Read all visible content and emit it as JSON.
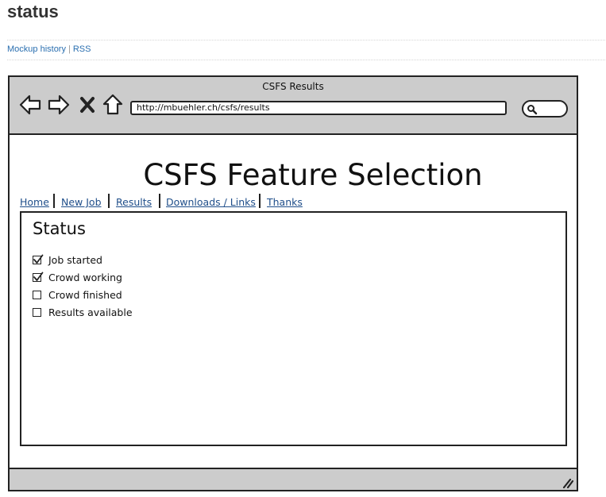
{
  "page": {
    "title": "status",
    "links": [
      {
        "label": "Mockup history"
      },
      {
        "label": "RSS"
      }
    ],
    "link_separator": "|"
  },
  "browser": {
    "window_title": "CSFS Results",
    "url": "http://mbuehler.ch/csfs/results",
    "icons": [
      "back-arrow-icon",
      "forward-arrow-icon",
      "close-x-icon",
      "home-icon",
      "search-icon",
      "resize-grip-icon"
    ]
  },
  "app": {
    "title": "CSFS Feature Selection",
    "tabs": [
      {
        "label": "Home"
      },
      {
        "label": "New Job"
      },
      {
        "label": "Results"
      },
      {
        "label": "Downloads / Links"
      },
      {
        "label": "Thanks"
      }
    ],
    "section_title": "Status",
    "status_items": [
      {
        "label": "Job started",
        "checked": true
      },
      {
        "label": "Crowd working",
        "checked": true
      },
      {
        "label": "Crowd finished",
        "checked": false
      },
      {
        "label": "Results available",
        "checked": false
      }
    ]
  },
  "colors": {
    "link": "#2a6fb0",
    "tab_link": "#1f4e8a",
    "chrome": "#cccccc",
    "outline": "#222222"
  }
}
